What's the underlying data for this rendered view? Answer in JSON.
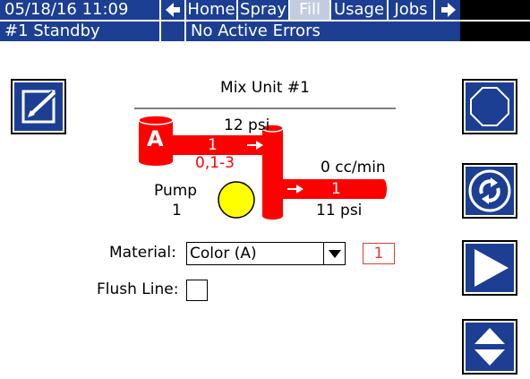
{
  "header": {
    "datetime": "05/18/16 11:09",
    "nav_left_icon": "arrow-left-icon",
    "nav_right_icon": "arrow-right-icon",
    "tabs": [
      {
        "label": "Home",
        "active": false
      },
      {
        "label": "Spray",
        "active": false
      },
      {
        "label": "Fill",
        "active": true
      },
      {
        "label": "Usage",
        "active": false
      },
      {
        "label": "Jobs",
        "active": false
      }
    ]
  },
  "status": {
    "mode": "#1 Standby",
    "errors": "No Active Errors"
  },
  "diagram": {
    "title": "Mix Unit #1",
    "inlet_pressure": "12 psi",
    "tank_label": "A",
    "material_number": "1",
    "color_code": "0,1-3",
    "flow_rate": "0 cc/min",
    "outlet_number": "1",
    "outlet_pressure": "11 psi",
    "pump_label": "Pump",
    "pump_number": "1"
  },
  "form": {
    "material_label": "Material:",
    "material_value": "Color (A)",
    "material_index": "1",
    "flush_label": "Flush Line:",
    "flush_checked": false
  },
  "side_buttons": {
    "edit_icon": "edit-icon",
    "stop_icon": "stop-icon",
    "refresh_icon": "refresh-icon",
    "play_icon": "play-icon",
    "up_down_icon": "up-down-arrows-icon"
  },
  "colors": {
    "bar_blue": "#1c3f94",
    "active_tab": "#c3ccdf",
    "pipe_red": "#ff0000",
    "pump_yellow": "#ffff00",
    "alert_red": "#e53935"
  }
}
